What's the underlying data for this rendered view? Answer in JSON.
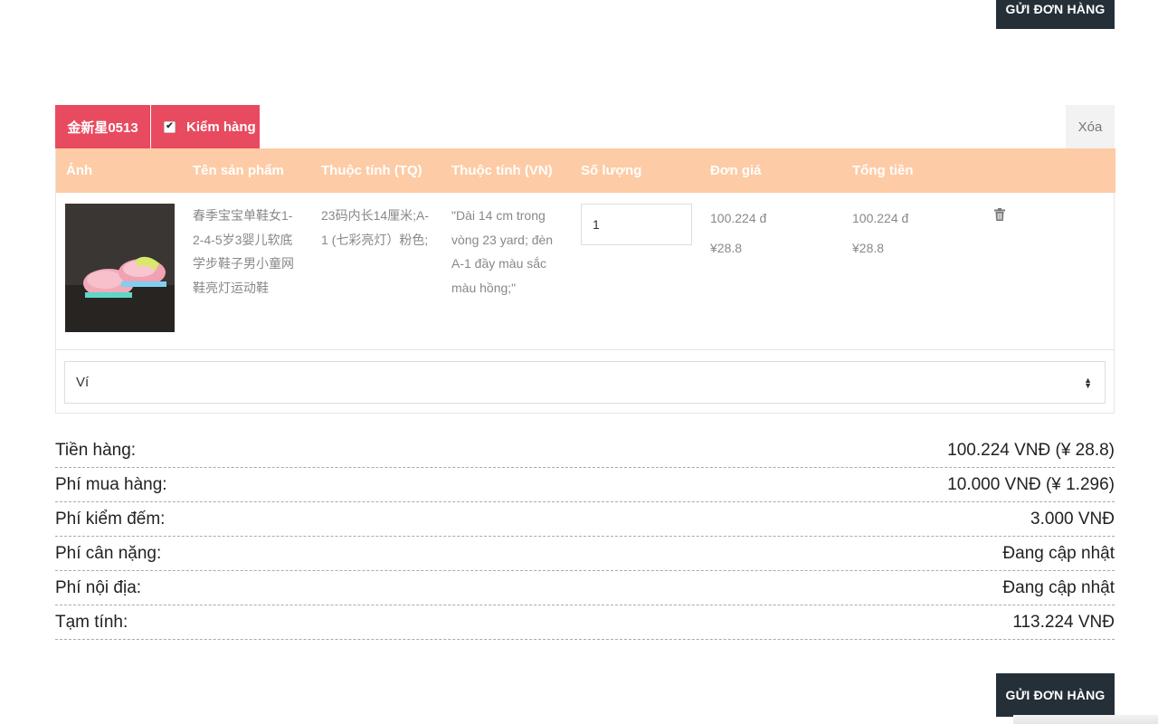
{
  "actions": {
    "submit_order": "GỬI ĐƠN HÀNG"
  },
  "shop": {
    "name": "金新星0513",
    "inspect_label": "Kiểm hàng",
    "inspect_checked": true,
    "delete_label": "Xóa"
  },
  "table": {
    "headers": [
      "Ảnh",
      "Tên sản phẩm",
      "Thuộc tính (TQ)",
      "Thuộc tính (VN)",
      "Số lượng",
      "Đơn giá",
      "Tổng tiền"
    ],
    "row": {
      "image_icon": "pink-sneaker-product-photo",
      "name_lines": [
        "春季宝宝单鞋女1-",
        "2-4-5岁3婴儿软底",
        "学步鞋子男小童网",
        "鞋亮灯运动鞋"
      ],
      "attr_tq_lines": [
        "23码内长14厘米;A-",
        "1 (七彩亮灯）粉色;"
      ],
      "attr_vn_lines": [
        "\"Dài 14 cm trong",
        "vòng 23 yard; đèn",
        "A-1 đầy màu sắc",
        "màu hồng;\""
      ],
      "quantity": "1",
      "unit_price_vnd": "100.224 đ",
      "unit_price_cny": "¥28.8",
      "total_vnd": "100.224 đ",
      "total_cny": "¥28.8",
      "delete_icon": "trash-icon"
    }
  },
  "payment_select": {
    "value": "Ví"
  },
  "summary": [
    {
      "label": "Tiền hàng:",
      "value": "100.224 VNĐ (¥ 28.8)"
    },
    {
      "label": "Phí mua hàng:",
      "value": "10.000 VNĐ (¥ 1.296)"
    },
    {
      "label": "Phí kiểm đếm:",
      "value": "3.000 VNĐ"
    },
    {
      "label": "Phí cân nặng:",
      "value": "Đang cập nhật"
    },
    {
      "label": "Phí nội địa:",
      "value": "Đang cập nhật"
    },
    {
      "label": "Tạm tính:",
      "value": "113.224 VNĐ"
    }
  ],
  "colors": {
    "accent": "#e84a5f",
    "header": "#fdcba5",
    "dark_button": "#252f38"
  }
}
